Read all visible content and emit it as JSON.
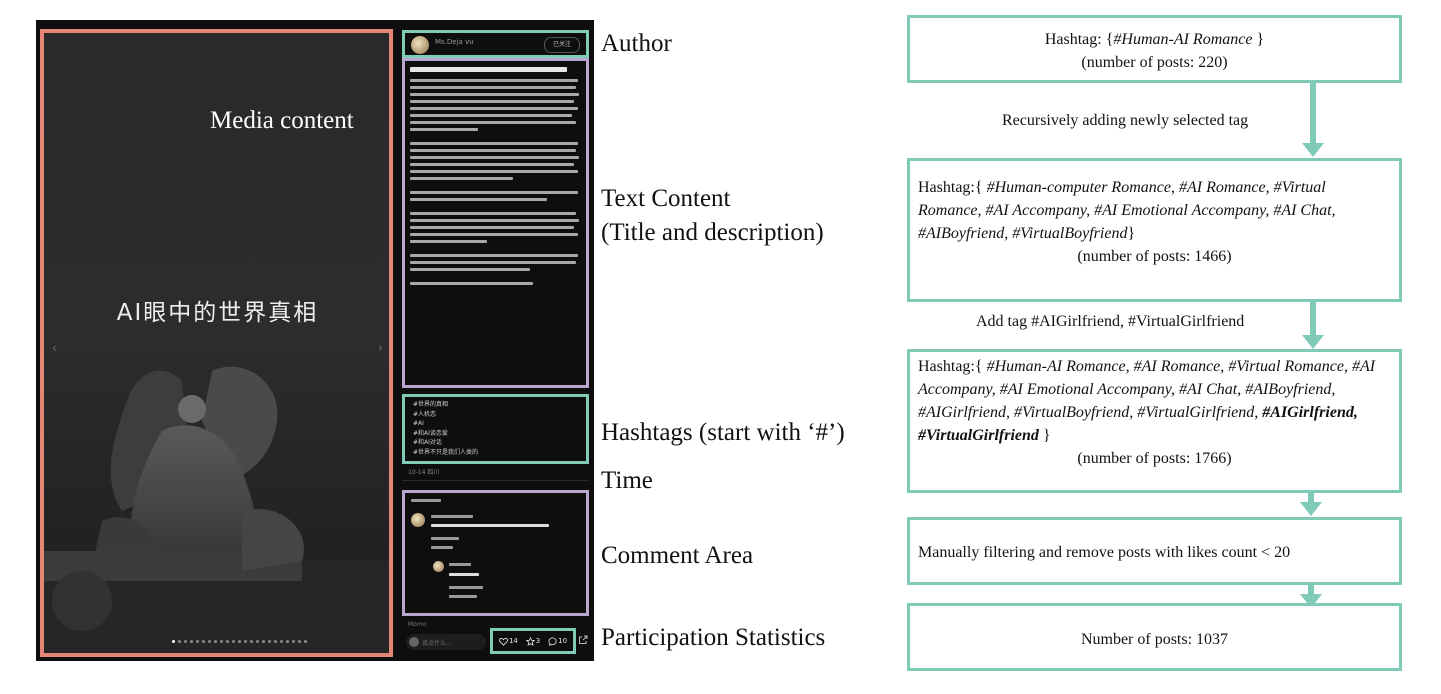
{
  "screenshot": {
    "media_title": "AI眼中的世界真相",
    "nav_prev": "‹",
    "nav_next": "›",
    "author_name": "Ms.Deja vu",
    "follow_label": "已关注",
    "hashtags": [
      "#世界的真相",
      "#人机恋",
      "#AI",
      "#和AI谈恋爱",
      "#和AI对话",
      "#世界不只是我们人类的"
    ],
    "time": "10-14 四川",
    "comment_peek": "Momo",
    "input_placeholder": "说点什么...",
    "stats": {
      "likes": "14",
      "stars": "3",
      "comments": "10"
    }
  },
  "labels": {
    "author": "Author",
    "media": "Media content",
    "text1": "Text Content",
    "text2": "(Title and description)",
    "hashtags": "Hashtags (start with ‘#’)",
    "time": "Time",
    "comments": "Comment Area",
    "stats": "Participation Statistics"
  },
  "flow": {
    "box1": {
      "prefix": "Hashtag: {",
      "tag": "#Human-AI Romance",
      "suffix": " }",
      "count": "(number of posts: 220)"
    },
    "step1": "Recursively adding newly selected tag",
    "box2": {
      "prefix": "Hashtag:{ ",
      "tags": "#Human-computer Romance, #AI Romance, #Virtual Romance, #AI Accompany, #AI Emotional Accompany, #AI Chat, #AIBoyfriend, #VirtualBoyfriend",
      "suffix": "}",
      "count": "(number of posts: 1466)"
    },
    "step2": "Add tag #AIGirlfriend, #VirtualGirlfriend",
    "box3": {
      "prefix": "Hashtag:{ ",
      "tags": "#Human-AI Romance, #AI Romance, #Virtual Romance, #AI Accompany, #AI Emotional Accompany, #AI Chat, #AIBoyfriend, #AIGirlfriend, #VirtualBoyfriend, #VirtualGirlfriend, ",
      "bold_tags": "#AIGirlfriend, #VirtualGirlfriend",
      "suffix": " }",
      "count": "(number of posts: 1766)"
    },
    "box4": "Manually filtering and remove posts with likes count < 20",
    "box5": "Number of posts: 1037"
  },
  "colors": {
    "teal": "#7fcbb8",
    "salmon": "#e58575",
    "lavender": "#b9a6cf"
  }
}
